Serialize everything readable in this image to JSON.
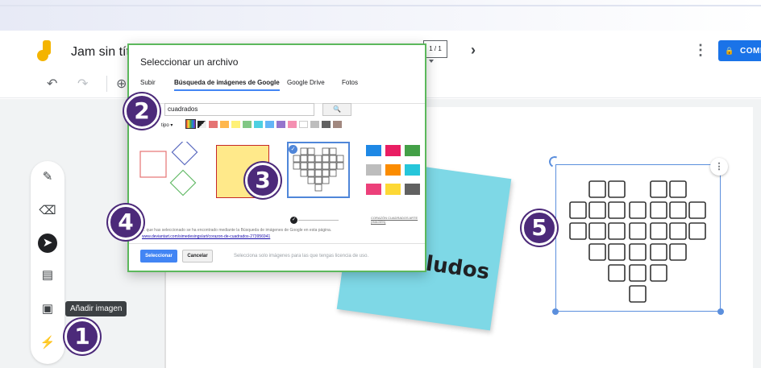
{
  "app": {
    "title": "Jam sin títul",
    "frame_counter": "1 / 1",
    "next_symbol": "›",
    "more_symbol": "⋮",
    "share_label": "COMP",
    "brand_color": "#f4b400",
    "accent_color": "#1a73e8"
  },
  "toolbar": {
    "undo_icon": "↶",
    "redo_icon": "↷",
    "zoom_icon": "⊕"
  },
  "tools": {
    "items": [
      {
        "name": "pen",
        "glyph": "✎"
      },
      {
        "name": "eraser",
        "glyph": "⌫"
      },
      {
        "name": "select",
        "glyph": "➤"
      },
      {
        "name": "sticky-note",
        "glyph": "▤"
      },
      {
        "name": "image",
        "glyph": "▣"
      },
      {
        "name": "laser",
        "glyph": "⚡"
      }
    ],
    "tooltip": "Añadir imagen"
  },
  "dialog": {
    "title": "Seleccionar un archivo",
    "tabs": [
      "Subir",
      "Búsqueda de imágenes de Google",
      "Google Drive",
      "Fotos"
    ],
    "active_tab": "Búsqueda de imágenes de Google",
    "search_value": "cuadrados",
    "search_button": "🔍",
    "filter_label": "tipo ▾",
    "attribution_text": "... que has seleccionado se ha encontrado mediante la Búsqueda de imágenes de Google en esta página.",
    "attribution_link": "www.deviantart.com/simedesings/art/corazon-de-cuadrados-273956941",
    "select_button": "Seleccionar",
    "cancel_button": "Cancelar",
    "license_note": "Selecciona solo imágenes para las que tengas licencia de uso.",
    "result_caption": "CORAZÓN CUADRADOS ARTE (IMAGEN)"
  },
  "canvas": {
    "sticky_text": "ludos",
    "sticky_color": "#7ed8e6",
    "selection_color": "#5b8fdd"
  },
  "callouts": [
    "1",
    "2",
    "3",
    "4",
    "5"
  ],
  "callout_color": "#4c2a7a"
}
